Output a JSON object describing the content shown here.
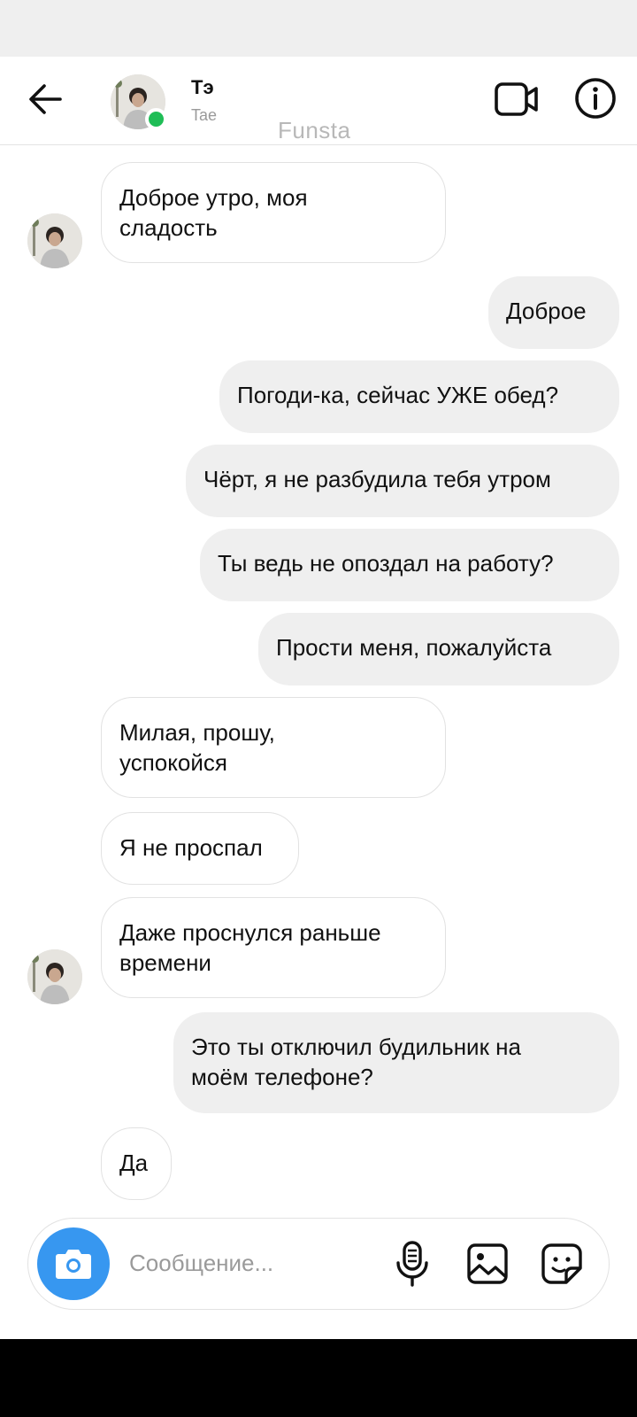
{
  "header": {
    "contact_name": "Тэ",
    "contact_username": "Tae",
    "watermark": "Funsta"
  },
  "messages": [
    {
      "side": "in",
      "text": "Доброе утро, моя\nсладость"
    },
    {
      "side": "out",
      "text": "Доброе"
    },
    {
      "side": "out",
      "text": "Погоди-ка, сейчас УЖЕ обед?"
    },
    {
      "side": "out",
      "text": "Чёрт, я не разбудила тебя утром"
    },
    {
      "side": "out",
      "text": "Ты ведь не опоздал на работу?"
    },
    {
      "side": "out",
      "text": "Прости меня, пожалуйста"
    },
    {
      "side": "in",
      "text": "Милая, прошу,\nуспокойся"
    },
    {
      "side": "in",
      "text": "Я не проспал"
    },
    {
      "side": "in",
      "text": "Даже проснулся раньше\nвремени"
    },
    {
      "side": "out",
      "text": "Это ты отключил будильник на\nмоём телефоне?"
    },
    {
      "side": "in",
      "text": "Да"
    }
  ],
  "composer": {
    "placeholder": "Сообщение..."
  },
  "icons": {
    "back": "arrow-left-icon",
    "video": "video-camera-icon",
    "info": "info-icon",
    "camera": "camera-icon",
    "mic": "microphone-icon",
    "gallery": "image-icon",
    "sticker": "sticker-icon"
  },
  "colors": {
    "accent": "#3797f0",
    "online": "#1fbd56",
    "outgoing_bubble": "#efefef",
    "incoming_border": "#e2e2e2"
  }
}
